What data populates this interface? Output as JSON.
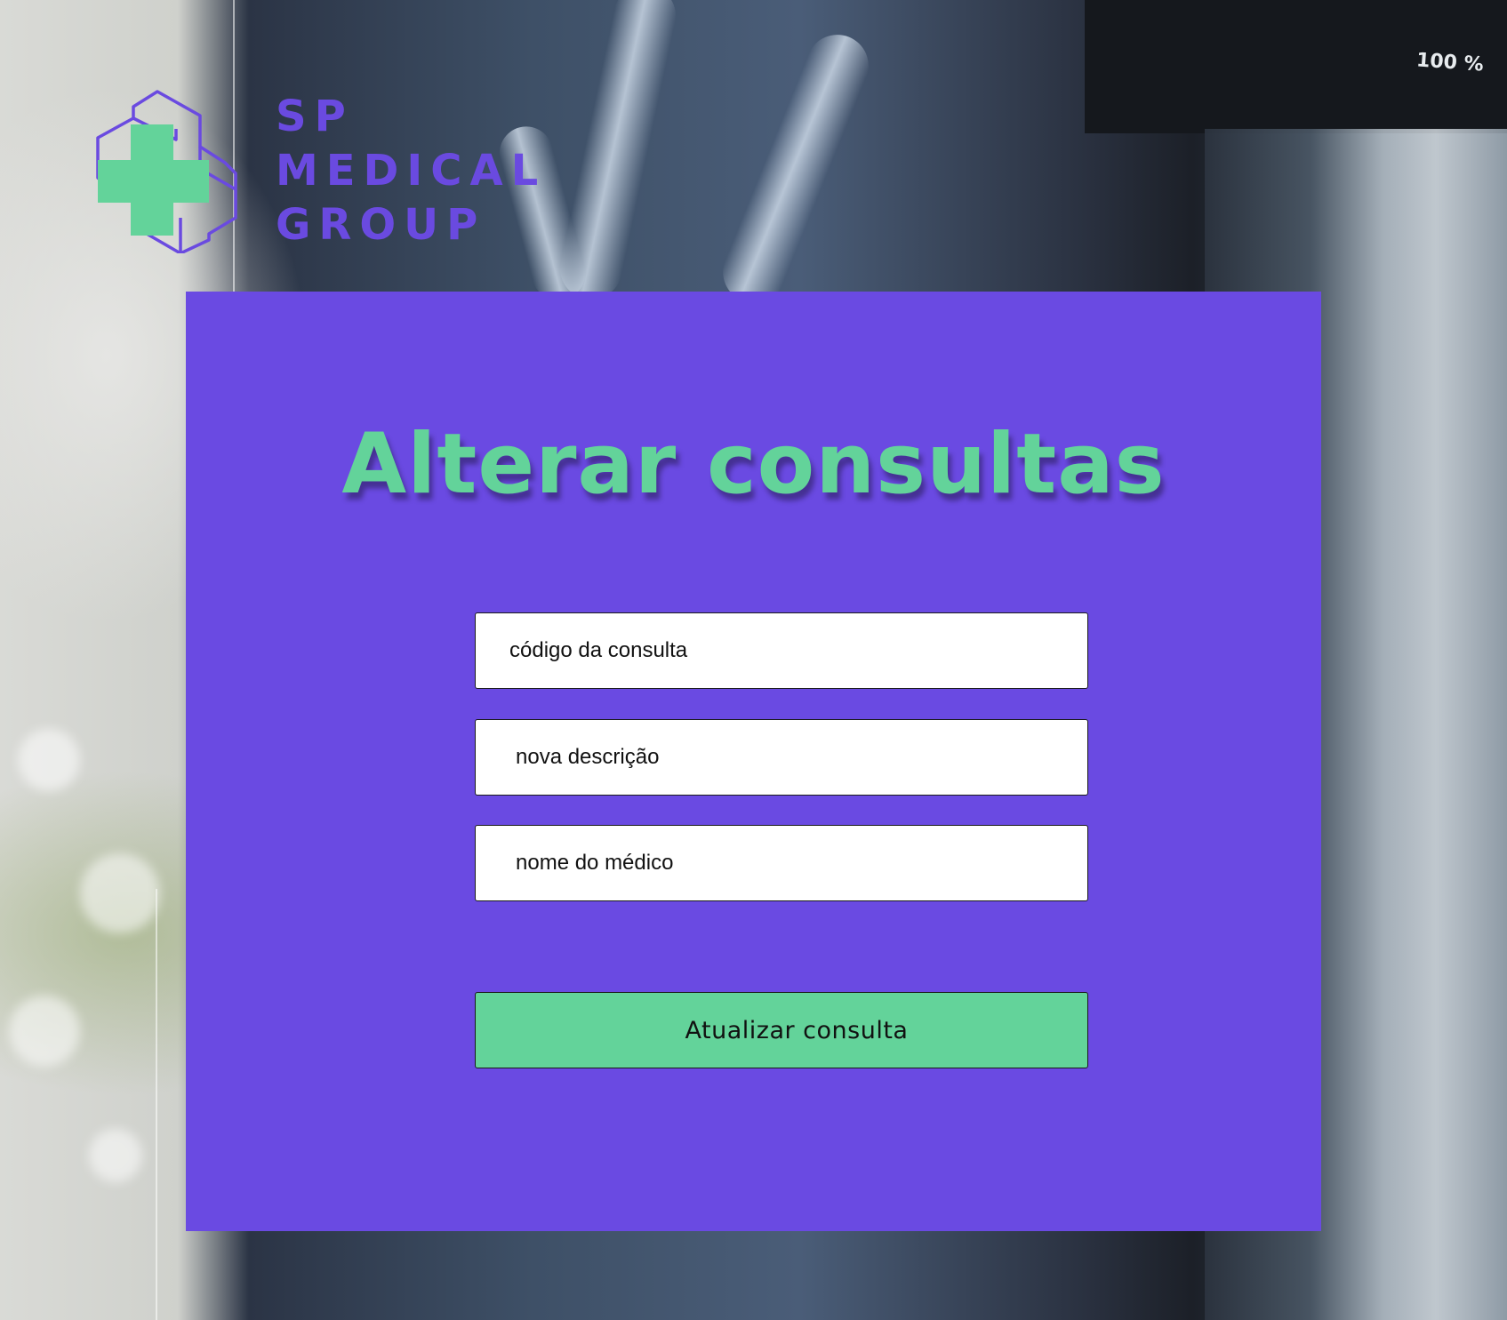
{
  "brand": {
    "name_lines": [
      "SP",
      "MEDICAL",
      "GROUP"
    ],
    "logo_icon": "medical-cross-cube-icon",
    "primary_color": "#6a4ae2",
    "accent_color": "#63d39a"
  },
  "background": {
    "monitor_zoom_label": "100 %"
  },
  "form": {
    "title": "Alterar consultas",
    "fields": {
      "code_placeholder": "código da consulta",
      "description_placeholder": "nova descrição",
      "doctor_placeholder": "nome do médico"
    },
    "submit_label": "Atualizar consulta"
  }
}
